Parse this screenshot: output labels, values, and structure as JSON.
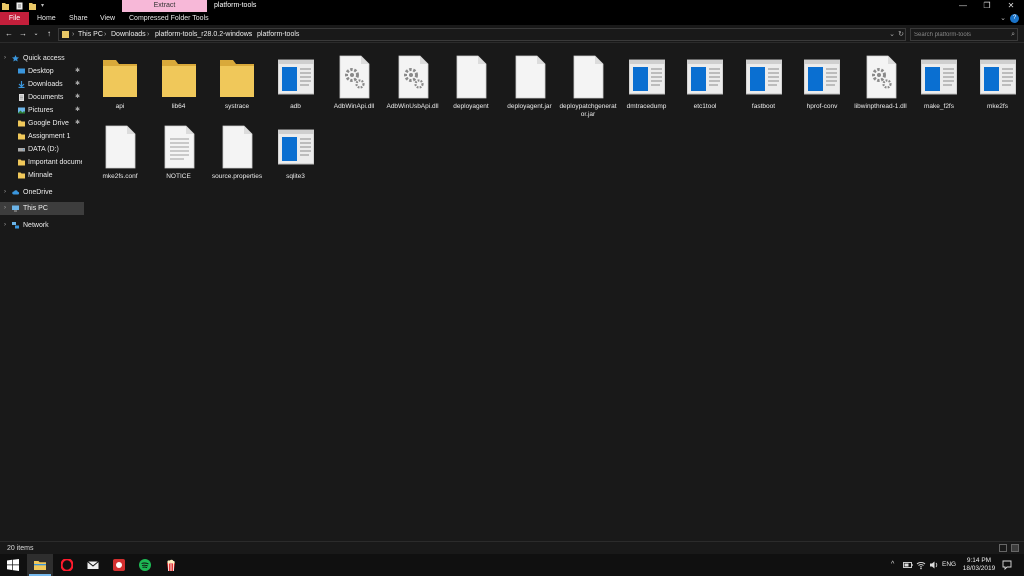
{
  "titlebar": {
    "context_tab": "Extract",
    "title": "platform-tools",
    "minimize_glyph": "—",
    "maximize_glyph": "❐",
    "close_glyph": "✕"
  },
  "ribbon": {
    "file": "File",
    "home": "Home",
    "share": "Share",
    "view": "View",
    "compressed": "Compressed Folder Tools",
    "expand_glyph": "⌄",
    "help_glyph": "?"
  },
  "address": {
    "back_glyph": "←",
    "forward_glyph": "→",
    "recent_glyph": "⌄",
    "up_glyph": "↑",
    "separator": "›",
    "crumbs": [
      "This PC",
      "Downloads",
      "platform-tools_r28.0.2-windows",
      "platform-tools"
    ],
    "dropdown_glyph": "⌄",
    "refresh_glyph": "↻"
  },
  "search": {
    "placeholder": "Search platform-tools",
    "icon_glyph": "⌕"
  },
  "nav": {
    "chevron": "›",
    "pin_glyph": "✱",
    "quick_access": "Quick access",
    "desktop": "Desktop",
    "downloads": "Downloads",
    "documents": "Documents",
    "pictures": "Pictures",
    "google_drive": "Google Drive",
    "assignment": "Assignment 1",
    "data_drive": "DATA (D:)",
    "important": "Important documents",
    "minnale": "Minnale",
    "onedrive": "OneDrive",
    "this_pc": "This PC",
    "network": "Network"
  },
  "files": [
    {
      "name": "api",
      "type": "folder"
    },
    {
      "name": "lib64",
      "type": "folder"
    },
    {
      "name": "systrace",
      "type": "folder"
    },
    {
      "name": "adb",
      "type": "exe"
    },
    {
      "name": "AdbWinApi.dll",
      "type": "dll"
    },
    {
      "name": "AdbWinUsbApi.dll",
      "type": "dll"
    },
    {
      "name": "deployagent",
      "type": "blank"
    },
    {
      "name": "deployagent.jar",
      "type": "blank"
    },
    {
      "name": "deploypatchgenerator.jar",
      "type": "blank"
    },
    {
      "name": "dmtracedump",
      "type": "exe"
    },
    {
      "name": "etc1tool",
      "type": "exe"
    },
    {
      "name": "fastboot",
      "type": "exe"
    },
    {
      "name": "hprof-conv",
      "type": "exe"
    },
    {
      "name": "libwinpthread-1.dll",
      "type": "dll"
    },
    {
      "name": "make_f2fs",
      "type": "exe"
    },
    {
      "name": "mke2fs",
      "type": "exe"
    },
    {
      "name": "mke2fs.conf",
      "type": "blank"
    },
    {
      "name": "NOTICE",
      "type": "text"
    },
    {
      "name": "source.properties",
      "type": "blank"
    },
    {
      "name": "sqlite3",
      "type": "exe"
    }
  ],
  "status": {
    "item_count": "20 items"
  },
  "taskbar": {
    "tray_up_glyph": "^",
    "language": "ENG",
    "time": "9:14 PM",
    "date": "18/03/2019"
  },
  "colors": {
    "background": "#191919",
    "file_tab": "#c41f3b",
    "extract_tab": "#f7b8d8",
    "folder": "#f0c85a",
    "accent_blue": "#0078d7"
  }
}
